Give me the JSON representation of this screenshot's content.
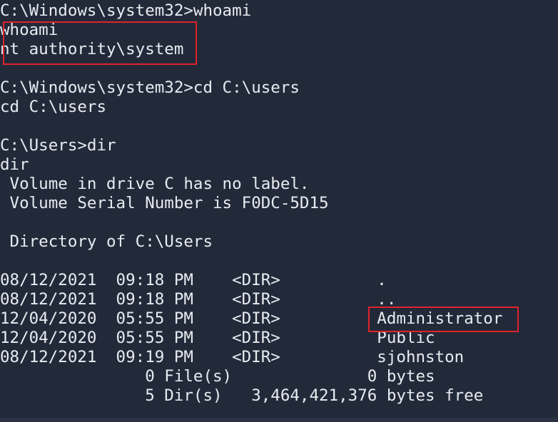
{
  "terminal": {
    "lines": [
      "C:\\Windows\\system32>whoami",
      "whoami",
      "nt authority\\system",
      "",
      "C:\\Windows\\system32>cd C:\\users",
      "cd C:\\users",
      "",
      "C:\\Users>dir",
      "dir",
      " Volume in drive C has no label.",
      " Volume Serial Number is F0DC-5D15",
      "",
      " Directory of C:\\Users",
      "",
      "08/12/2021  09:18 PM    <DIR>          .",
      "08/12/2021  09:18 PM    <DIR>          ..",
      "12/04/2020  05:55 PM    <DIR>          Administrator",
      "12/04/2020  05:55 PM    <DIR>          Public",
      "08/12/2021  09:19 PM    <DIR>          sjohnston",
      "               0 File(s)              0 bytes",
      "               5 Dir(s)   3,464,421,376 bytes free"
    ]
  },
  "colors": {
    "background": "#222a3a",
    "foreground": "#e8ebf0",
    "highlight": "#e0232a"
  }
}
